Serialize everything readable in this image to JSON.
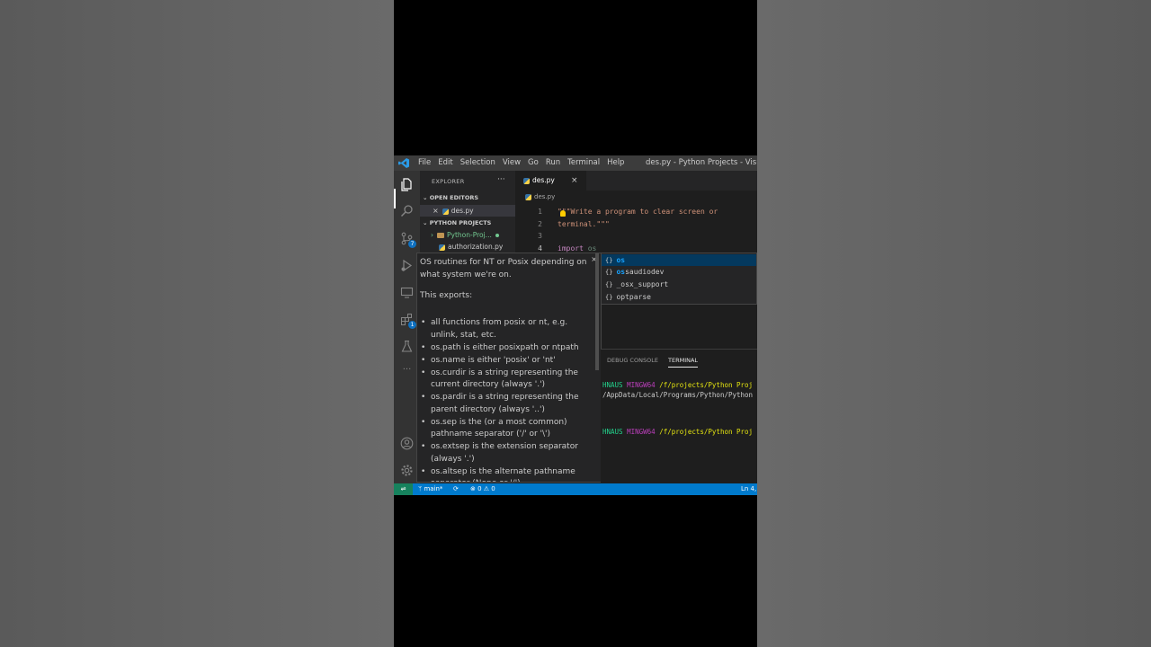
{
  "window": {
    "title": "des.py - Python Projects - Visual Studio Code",
    "menu": [
      "File",
      "Edit",
      "Selection",
      "View",
      "Go",
      "Run",
      "Terminal",
      "Help"
    ]
  },
  "activity_bar": {
    "items": [
      "explorer-icon",
      "search-icon",
      "source-control-icon",
      "run-debug-icon",
      "remote-explorer-icon",
      "extensions-icon",
      "testing-icon",
      "more-icon"
    ],
    "source_control_badge": "7",
    "bottom": [
      "accounts-icon",
      "manage-gear-icon"
    ]
  },
  "explorer": {
    "header": "EXPLORER",
    "more": "···",
    "open_editors_title": "OPEN EDITORS",
    "open_editors": [
      {
        "name": "des.py"
      }
    ],
    "workspace_title": "PYTHON PROJECTS",
    "tree": [
      {
        "name": "Python-Proj..."
      },
      {
        "name": "authorization.py"
      }
    ]
  },
  "editor": {
    "tab": "des.py",
    "breadcrumb": "des.py",
    "lines": [
      {
        "n": "1",
        "text": "\"\"\"Write a program to clear screen or"
      },
      {
        "n": "2",
        "text": "terminal.\"\"\""
      },
      {
        "n": "3",
        "text": ""
      },
      {
        "n": "4",
        "keyword": "import",
        "rest": " os"
      }
    ]
  },
  "suggest": {
    "items": [
      {
        "icon": "{}",
        "match": "os",
        "rest": ""
      },
      {
        "icon": "{}",
        "match": "os",
        "rest": "saudiodev"
      },
      {
        "icon": "{}",
        "match": "",
        "rest": "_osx_support"
      },
      {
        "icon": "{}",
        "match": "",
        "rest": "optparse"
      }
    ]
  },
  "docs": {
    "close": "×",
    "intro": "OS routines for NT or Posix depending on what system we're on.",
    "exports": "This exports:",
    "bullets": [
      "all functions from posix or nt, e.g. unlink, stat, etc.",
      "os.path is either posixpath or ntpath",
      "os.name is either 'posix' or 'nt'",
      "os.curdir is a string representing the current directory (always '.')",
      "os.pardir is a string representing the parent directory (always '..')",
      "os.sep is the (or a most common) pathname separator ('/' or '\\')",
      "os.extsep is the extension separator (always '.')",
      "os.altsep is the alternate pathname separator (None or '/')"
    ]
  },
  "panel": {
    "tabs": [
      "DEBUG CONSOLE",
      "TERMINAL"
    ],
    "terminal": {
      "line1_user": "HNAUS",
      "line1_shell": "MINGW64",
      "line1_path": "/f/projects/Python Proj",
      "line2": "/AppData/Local/Programs/Python/Python",
      "line3_user": "HNAUS",
      "line3_shell": "MINGW64",
      "line3_path": "/f/projects/Python Proj"
    }
  },
  "status_bar": {
    "branch": "main*",
    "errors": "0",
    "warnings": "0",
    "position": "Ln 4,"
  }
}
